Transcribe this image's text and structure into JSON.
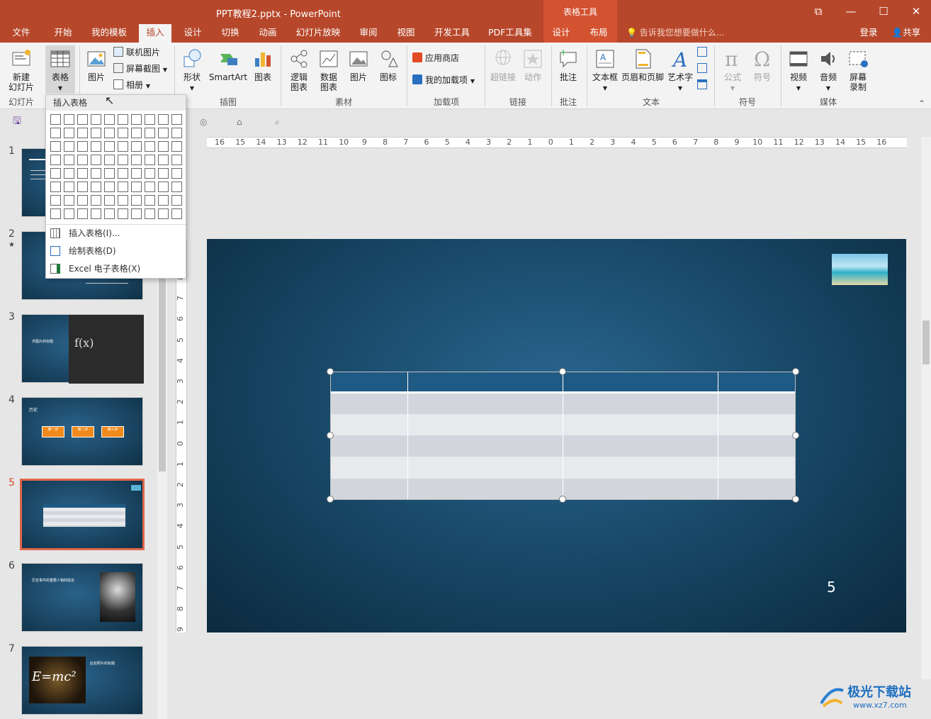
{
  "titlebar": {
    "title": "PPT教程2.pptx - PowerPoint",
    "context": "表格工具"
  },
  "tabs": [
    {
      "label": "文件"
    },
    {
      "label": "开始"
    },
    {
      "label": "我的模板"
    },
    {
      "label": "插入"
    },
    {
      "label": "设计"
    },
    {
      "label": "切换"
    },
    {
      "label": "动画"
    },
    {
      "label": "幻灯片放映"
    },
    {
      "label": "审阅"
    },
    {
      "label": "视图"
    },
    {
      "label": "开发工具"
    },
    {
      "label": "PDF工具集"
    },
    {
      "label": "设计"
    },
    {
      "label": "布局"
    }
  ],
  "tellme": "告诉我您想要做什么...",
  "account": {
    "login": "登录",
    "share": "共享"
  },
  "ribbon": {
    "new_slide": "新建\n幻灯片",
    "table": "表格",
    "picture": "图片",
    "online_picture": "联机图片",
    "screenshot": "屏幕截图",
    "album": "相册",
    "shapes": "形状",
    "smartart": "SmartArt",
    "chart": "图表",
    "logic_chart": "逻辑\n图表",
    "data_chart": "数据\n图表",
    "pic2": "图片",
    "icon": "图标",
    "app_store": "应用商店",
    "my_addins": "我的加载项",
    "hyperlink": "超链接",
    "action": "动作",
    "comment": "批注",
    "textbox": "文本框",
    "header_footer": "页眉和页脚",
    "wordart": "艺术字",
    "equation": "公式",
    "symbol": "符号",
    "video": "视频",
    "audio": "音频",
    "screen_record": "屏幕\n录制",
    "groups": {
      "slides": "幻灯片",
      "illus": "插图",
      "material": "素材",
      "addins": "加载项",
      "links": "链接",
      "comments": "批注",
      "text": "文本",
      "symbols": "符号",
      "media": "媒体"
    }
  },
  "dropdown": {
    "title": "插入表格",
    "items": [
      {
        "label": "插入表格(I)..."
      },
      {
        "label": "绘制表格(D)"
      },
      {
        "label": "Excel 电子表格(X)"
      }
    ]
  },
  "thumbnails": [
    {
      "num": "1"
    },
    {
      "num": "2",
      "star": "★"
    },
    {
      "num": "3"
    },
    {
      "num": "4"
    },
    {
      "num": "5"
    },
    {
      "num": "6"
    },
    {
      "num": "7"
    }
  ],
  "thumb_text": {
    "t3_title": "洪图片的标题",
    "t4_title": "历史",
    "t4_steps": [
      "第一步",
      "第二步",
      "第三步"
    ],
    "t6_title": "历史事件的重要人物的姓名",
    "t7_title": "此处照片的标题",
    "t7_formula": "E=mc²"
  },
  "ruler_h": [
    "16",
    "15",
    "14",
    "13",
    "12",
    "11",
    "10",
    "9",
    "8",
    "7",
    "6",
    "5",
    "4",
    "3",
    "2",
    "1",
    "0",
    "1",
    "2",
    "3",
    "4",
    "5",
    "6",
    "7",
    "8",
    "9",
    "10",
    "11",
    "12",
    "13",
    "14",
    "15",
    "16"
  ],
  "ruler_v": [
    "8",
    "7",
    "6",
    "5",
    "4",
    "3",
    "2",
    "1",
    "0",
    "1",
    "2",
    "3",
    "4",
    "5",
    "6",
    "7",
    "8",
    "9"
  ],
  "slide": {
    "number": "5"
  },
  "table": {
    "rows": 6,
    "cols": 4
  },
  "watermark": {
    "text": "极光下载站",
    "url": "www.xz7.com"
  }
}
